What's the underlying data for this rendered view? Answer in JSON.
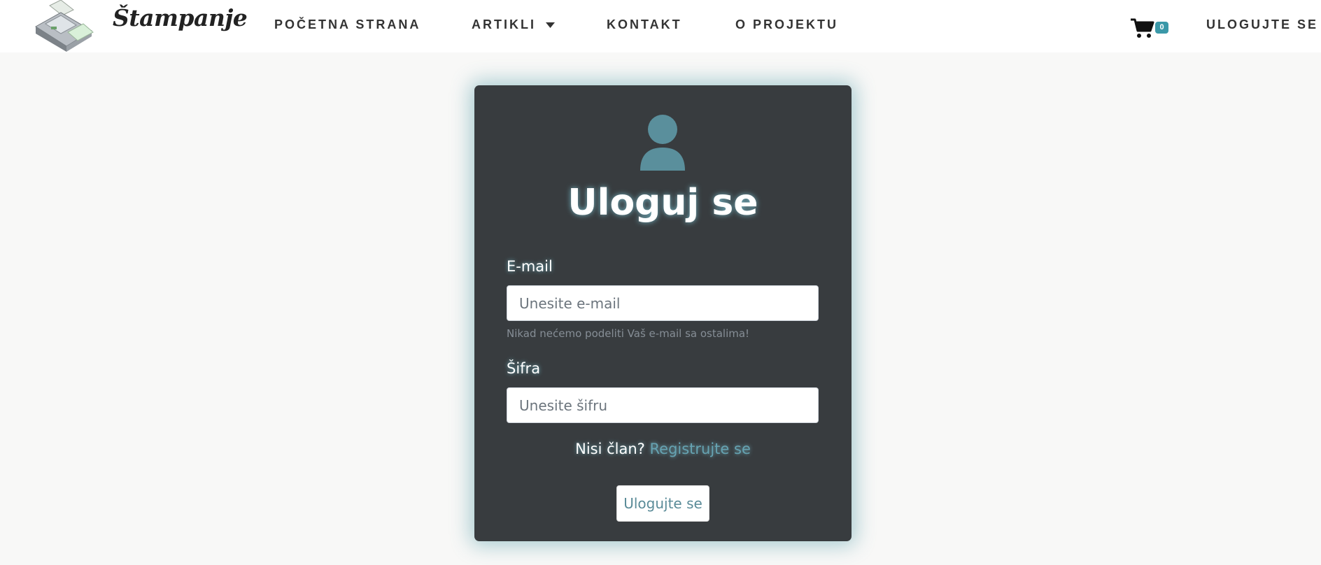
{
  "brand": {
    "name": "Štampanje"
  },
  "nav": {
    "home": "POČETNA STRANA",
    "artikli": "ARTIKLI",
    "kontakt": "KONTAKT",
    "projekt": "O PROJEKTU",
    "login": "ULOGUJTE SE",
    "cart_count": "0"
  },
  "form": {
    "title": "Uloguj se",
    "email_label": "E-mail",
    "email_placeholder": "Unesite e-mail",
    "email_help": "Nikad nećemo podeliti Vaš e-mail sa ostalima!",
    "password_label": "Šifra",
    "password_placeholder": "Unesite šifru",
    "register_prompt": "Nisi član?",
    "register_link": "Registrujte se",
    "submit": "Ulogujte se"
  },
  "colors": {
    "card_bg": "#383c3f",
    "accent": "#3a98a8",
    "link": "#66a3b2",
    "icon": "#5a8f9c",
    "page_bg": "#f8f8f7"
  },
  "icons": {
    "logo": "printer-icon",
    "dropdown": "caret-down-icon",
    "cart": "cart-icon",
    "user": "user-icon"
  }
}
